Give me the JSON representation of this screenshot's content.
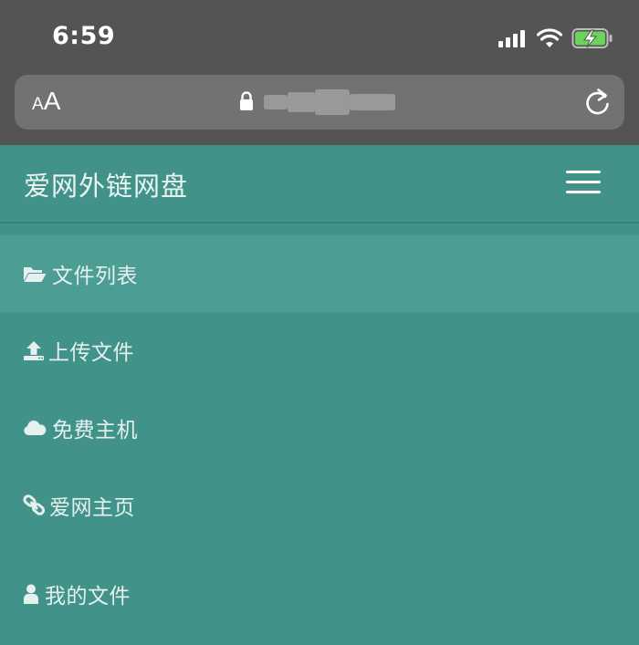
{
  "status_bar": {
    "time": "6:59"
  },
  "browser": {
    "text_size_label_small": "A",
    "text_size_label_large": "A",
    "url_blurred": true
  },
  "app": {
    "brand": "爱网外链网盘"
  },
  "nav": {
    "items": [
      {
        "label": "文件列表",
        "icon": "folder-open-icon",
        "active": true
      },
      {
        "label": "上传文件",
        "icon": "upload-icon",
        "active": false
      },
      {
        "label": "免费主机",
        "icon": "cloud-icon",
        "active": false
      },
      {
        "label": "爱网主页",
        "icon": "link-icon",
        "active": false
      },
      {
        "label": "我的文件",
        "icon": "user-icon",
        "active": false
      }
    ]
  },
  "colors": {
    "status_bar_bg": "#545454",
    "url_bar_bg": "#727272",
    "theme": "#41938a",
    "active_item": "#4c9e95",
    "battery_green": "#6bd25c"
  }
}
